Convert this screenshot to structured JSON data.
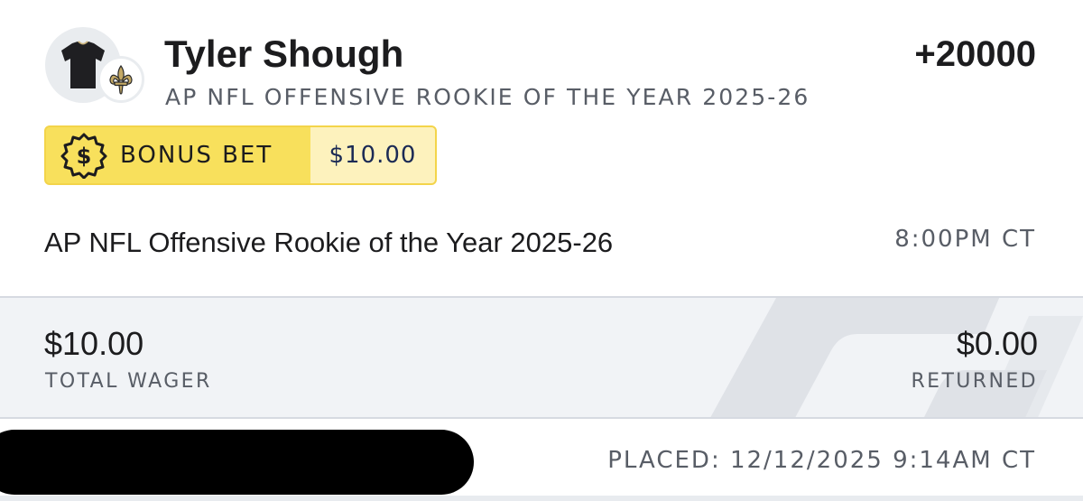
{
  "bet": {
    "player_name": "Tyler Shough",
    "odds": "+20000",
    "market": "AP NFL OFFENSIVE ROOKIE OF THE YEAR 2025-26",
    "avatar_icon": "jersey-icon",
    "team_icon": "fleur-de-lis-icon"
  },
  "bonus": {
    "icon": "dollar-badge-icon",
    "label": "BONUS BET",
    "amount": "$10.00",
    "colors": {
      "pill": "#f8e05c",
      "amount_bg": "#fdf2bd",
      "amount_text": "#1b2a55"
    }
  },
  "event": {
    "name": "AP NFL Offensive Rookie of the Year 2025-26",
    "time": "8:00PM CT"
  },
  "summary": {
    "total_wager_amount": "$10.00",
    "total_wager_label": "TOTAL WAGER",
    "returned_amount": "$0.00",
    "returned_label": "RETURNED"
  },
  "footer": {
    "placed": "PLACED: 12/12/2025 9:14AM CT"
  }
}
